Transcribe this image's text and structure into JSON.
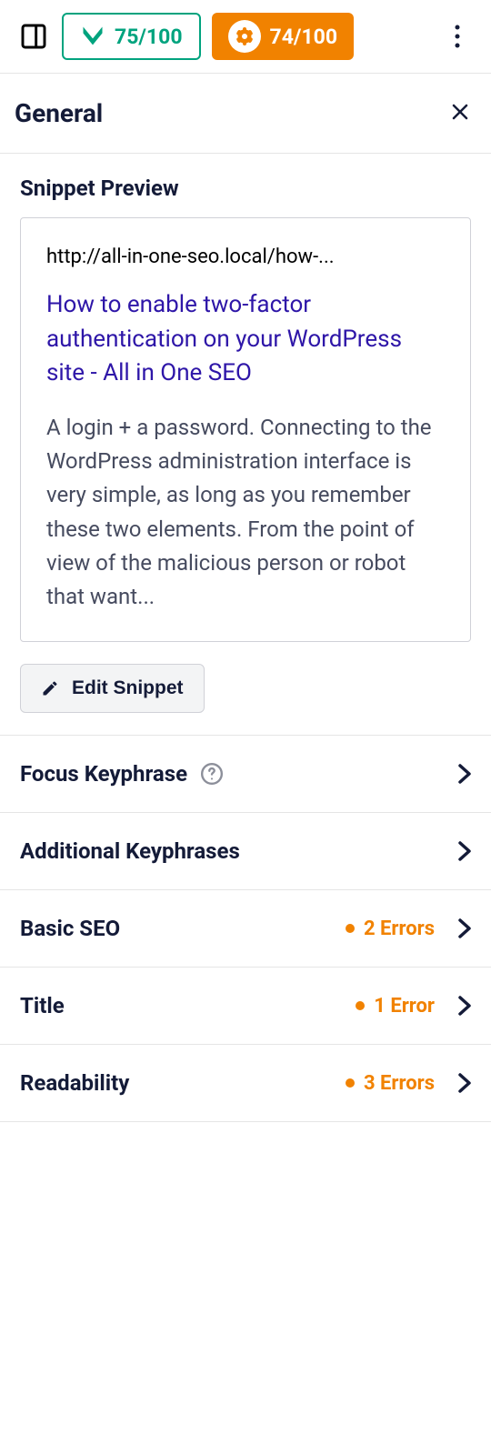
{
  "topbar": {
    "score_green": "75/100",
    "score_orange": "74/100"
  },
  "section": {
    "title": "General"
  },
  "snippet": {
    "heading": "Snippet Preview",
    "url": "http://all-in-one-seo.local/how-...",
    "title": "How to enable two-factor authentication on your WordPress site - All in One SEO",
    "description": "A login + a password. Connecting to the WordPress administration interface is very simple, as long as you remember these two elements. From the point of view of the malicious person or robot that want...",
    "edit_button": "Edit Snippet"
  },
  "accordion": [
    {
      "label": "Focus Keyphrase",
      "help": true,
      "errors": null
    },
    {
      "label": "Additional Keyphrases",
      "help": false,
      "errors": null
    },
    {
      "label": "Basic SEO",
      "help": false,
      "errors": "2 Errors"
    },
    {
      "label": "Title",
      "help": false,
      "errors": "1 Error"
    },
    {
      "label": "Readability",
      "help": false,
      "errors": "3 Errors"
    }
  ]
}
